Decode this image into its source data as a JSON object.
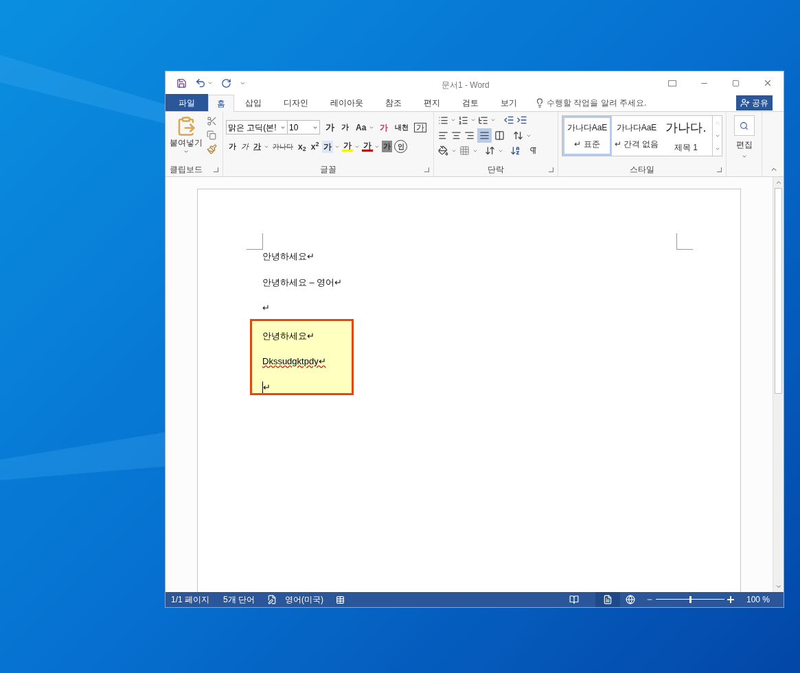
{
  "window": {
    "title": "문서1 - Word"
  },
  "tabs": [
    {
      "label": "파일",
      "kind": "file",
      "selected": false
    },
    {
      "label": "홈",
      "kind": "tab",
      "selected": true
    },
    {
      "label": "삽입",
      "kind": "tab",
      "selected": false
    },
    {
      "label": "디자인",
      "kind": "tab",
      "selected": false
    },
    {
      "label": "레이아웃",
      "kind": "tab",
      "selected": false
    },
    {
      "label": "참조",
      "kind": "tab",
      "selected": false
    },
    {
      "label": "편지",
      "kind": "tab",
      "selected": false
    },
    {
      "label": "검토",
      "kind": "tab",
      "selected": false
    },
    {
      "label": "보기",
      "kind": "tab",
      "selected": false
    }
  ],
  "tell_me": {
    "placeholder": "수행할 작업을 알려 주세요."
  },
  "share_button": "공유",
  "ribbon": {
    "clipboard": {
      "paste": "붙여넣기",
      "label": "클립보드"
    },
    "font": {
      "name": "맑은 고딕(본!",
      "size": "10",
      "label": "글꼴",
      "row_1": [
        {
          "glyph": "가",
          "kind": "grow"
        },
        {
          "glyph": "가",
          "kind": "shrink"
        },
        {
          "glyph": "Aa",
          "kind": "case"
        },
        {
          "glyph": "가",
          "kind": "clear"
        },
        {
          "glyph": "내천",
          "kind": "phonetic"
        },
        {
          "glyph": "가",
          "kind": "boxed"
        }
      ],
      "row_2": [
        {
          "glyph": "가",
          "kind": "bold"
        },
        {
          "glyph": "가",
          "kind": "italic"
        },
        {
          "glyph": "가",
          "kind": "underline"
        },
        {
          "glyph": "가나다",
          "kind": "strike"
        },
        {
          "glyph": "x$_{2}$",
          "kind": "sub"
        },
        {
          "glyph": "x$^{2}$",
          "kind": "sup"
        },
        {
          "glyph": "가",
          "kind": "effect"
        },
        {
          "glyph": "가",
          "kind": "highlight"
        },
        {
          "glyph": "가",
          "kind": "color"
        },
        {
          "glyph": "가",
          "kind": "shade"
        },
        {
          "glyph": "인",
          "kind": "enclose"
        }
      ]
    },
    "paragraph": {
      "label": "단락",
      "justify_selected": true
    },
    "styles": {
      "label": "스타일",
      "items": [
        {
          "preview": "가나다AaE",
          "name": "↵ 표준",
          "kind": "normal",
          "selected": true
        },
        {
          "preview": "가나다AaE",
          "name": "↵ 간격 없음",
          "kind": "normal",
          "selected": false
        },
        {
          "preview": "가나다.",
          "name": "제목 1",
          "kind": "heading",
          "selected": false
        }
      ]
    },
    "editing": {
      "label": "편집"
    }
  },
  "document": {
    "paragraphs": [
      "안녕하세요↵",
      "안녕하세요 – 영어↵",
      "↵"
    ],
    "text_box": {
      "selected": true,
      "paragraphs": [
        {
          "text": "안녕하세요↵",
          "misspelled": false,
          "caret": false
        },
        {
          "text": "Dkssudgktpdy↵",
          "misspelled": true,
          "caret": false
        },
        {
          "text": "↵",
          "misspelled": false,
          "caret": true
        }
      ]
    }
  },
  "status_bar": {
    "page": "1/1 페이지",
    "words": "5개 단어",
    "language": "영어(미국)",
    "zoom": "100 %",
    "zoom_slider": {
      "level": 0.5
    }
  }
}
